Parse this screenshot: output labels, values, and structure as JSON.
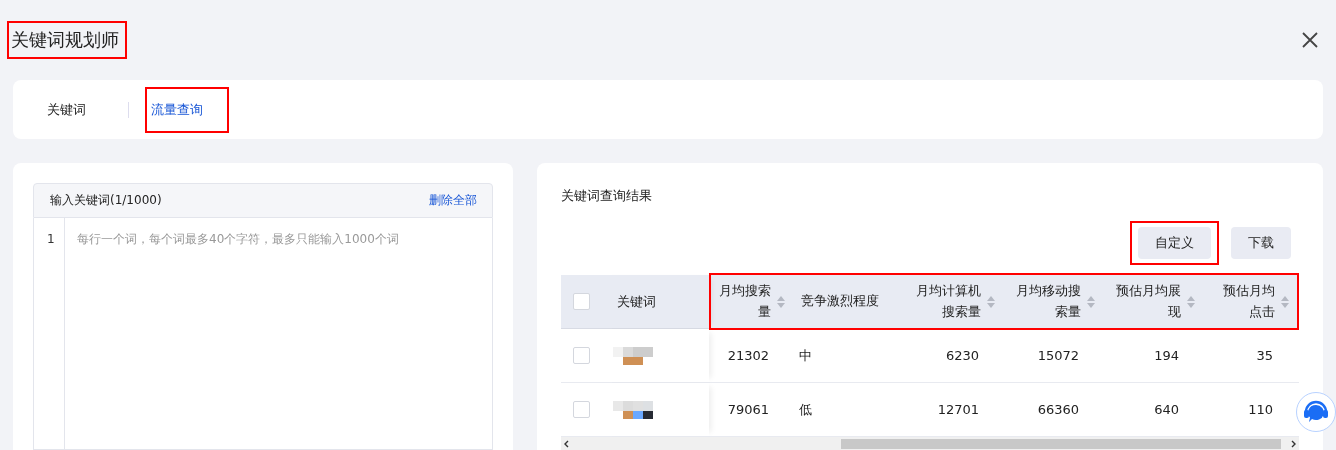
{
  "window": {
    "title": "关键词规划师",
    "highlighted": true
  },
  "tabs": [
    {
      "label": "关键词",
      "selected": false,
      "highlighted": false
    },
    {
      "label": "流量查询",
      "selected": true,
      "highlighted": true
    }
  ],
  "input_panel": {
    "label": "输入关键词(1/1000)",
    "clear_link": "删除全部",
    "line_numbers": [
      "1"
    ],
    "placeholder": "每行一个词，每个词最多40个字符，最多只能输入1000个词"
  },
  "results": {
    "title": "关键词查询结果",
    "buttons": [
      {
        "label": "自定义",
        "highlighted": true
      },
      {
        "label": "下载",
        "highlighted": false
      }
    ],
    "table": {
      "select_all_checked": false,
      "keyword_column": "关键词",
      "columns_highlighted": true,
      "columns": [
        {
          "label": "月均搜索量",
          "sortable": true
        },
        {
          "label": "竞争激烈程度",
          "sortable": false
        },
        {
          "label": "月均计算机搜索量",
          "sortable": true
        },
        {
          "label": "月均移动搜索量",
          "sortable": true
        },
        {
          "label": "预估月均展现",
          "sortable": true
        },
        {
          "label": "预估月均点击",
          "sortable": true
        }
      ],
      "rows": [
        {
          "checked": false,
          "values": [
            "21302",
            "中",
            "6230",
            "15072",
            "194",
            "35"
          ]
        },
        {
          "checked": false,
          "values": [
            "79061",
            "低",
            "12701",
            "66360",
            "640",
            "110"
          ]
        }
      ]
    }
  }
}
